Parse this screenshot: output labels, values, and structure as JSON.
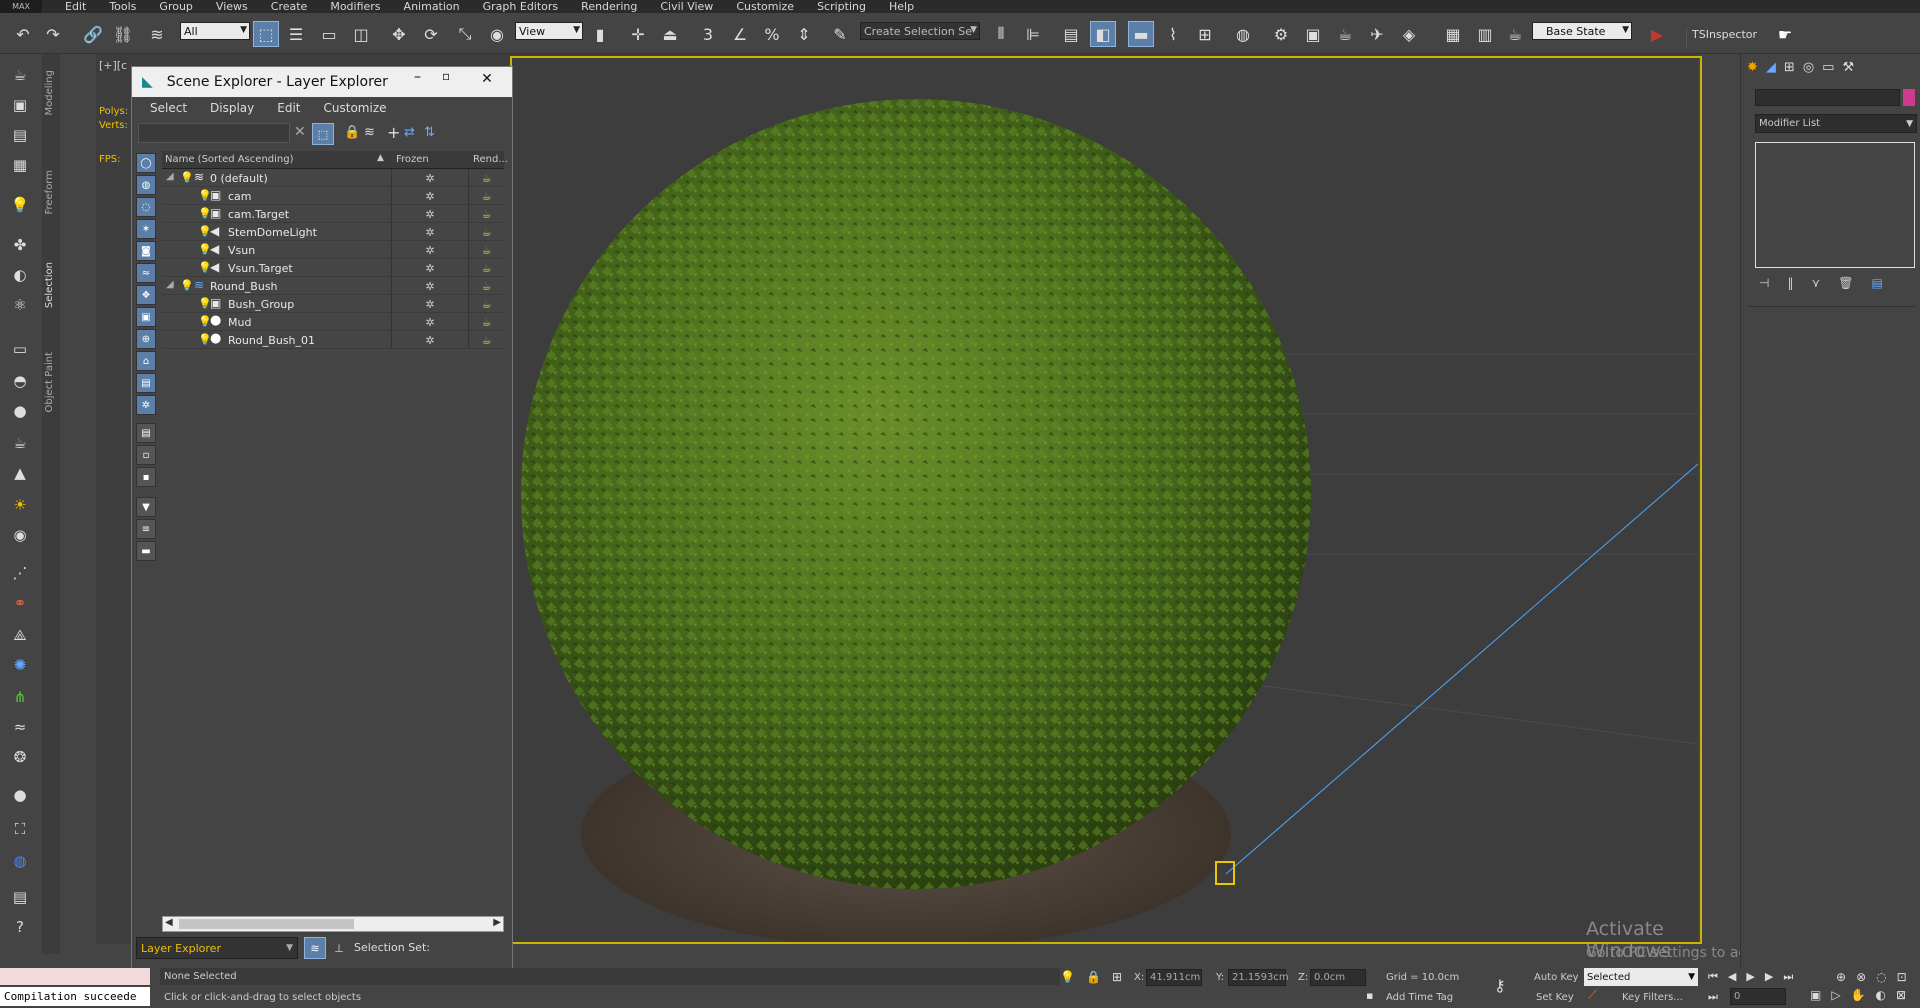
{
  "menubar": {
    "logo": "MAX",
    "items": [
      "Edit",
      "Tools",
      "Group",
      "Views",
      "Create",
      "Modifiers",
      "Animation",
      "Graph Editors",
      "Rendering",
      "Civil View",
      "Customize",
      "Scripting",
      "Help"
    ]
  },
  "toolbar": {
    "selection_filter": "All",
    "ref_coord": "View",
    "named_selection": "Create Selection Se",
    "state": "Base State",
    "plugin_label": "TSInspector",
    "snap_label": "3",
    "percent_snap": "%"
  },
  "ribbon_tabs": [
    "Modeling",
    "Freeform",
    "Selection",
    "Object Paint"
  ],
  "viewport": {
    "label": "[+][c",
    "stats_polys": "Polys:",
    "stats_verts": "Verts:",
    "stats_fps": "FPS:",
    "watermark_title": "Activate Windows",
    "watermark_sub": "Go to PC settings to activate Windows."
  },
  "scene_explorer": {
    "title": "Scene Explorer - Layer Explorer",
    "menu": [
      "Select",
      "Display",
      "Edit",
      "Customize"
    ],
    "columns": {
      "name": "Name (Sorted Ascending)",
      "frozen": "Frozen",
      "render": "Rend..."
    },
    "rows": [
      {
        "name": "0 (default)",
        "type": "layer",
        "indent": 0
      },
      {
        "name": "cam",
        "type": "camera",
        "indent": 1
      },
      {
        "name": "cam.Target",
        "type": "camera",
        "indent": 1
      },
      {
        "name": "StemDomeLight",
        "type": "light",
        "indent": 1
      },
      {
        "name": "Vsun",
        "type": "light",
        "indent": 1
      },
      {
        "name": "Vsun.Target",
        "type": "light",
        "indent": 1
      },
      {
        "name": "Round_Bush",
        "type": "layer",
        "indent": 0
      },
      {
        "name": "Bush_Group",
        "type": "group",
        "indent": 1
      },
      {
        "name": "Mud",
        "type": "geometry",
        "indent": 1
      },
      {
        "name": "Round_Bush_01",
        "type": "geometry",
        "indent": 1
      }
    ],
    "footer_explorer": "Layer Explorer",
    "footer_selection_set": "Selection Set:"
  },
  "command_panel": {
    "modifier_list": "Modifier List"
  },
  "status": {
    "listener": "Compilation succeede",
    "selection": "None Selected",
    "prompt": "Click or click-and-drag to select objects",
    "x_label": "X:",
    "x_value": "41.911cm",
    "y_label": "Y:",
    "y_value": "21.1593cm",
    "z_label": "Z:",
    "z_value": "0.0cm",
    "grid": "Grid = 10.0cm",
    "add_time_tag": "Add Time Tag",
    "auto_key": "Auto Key",
    "set_key": "Set Key",
    "key_mode": "Selected",
    "key_filters": "Key Filters...",
    "frame": "0"
  }
}
